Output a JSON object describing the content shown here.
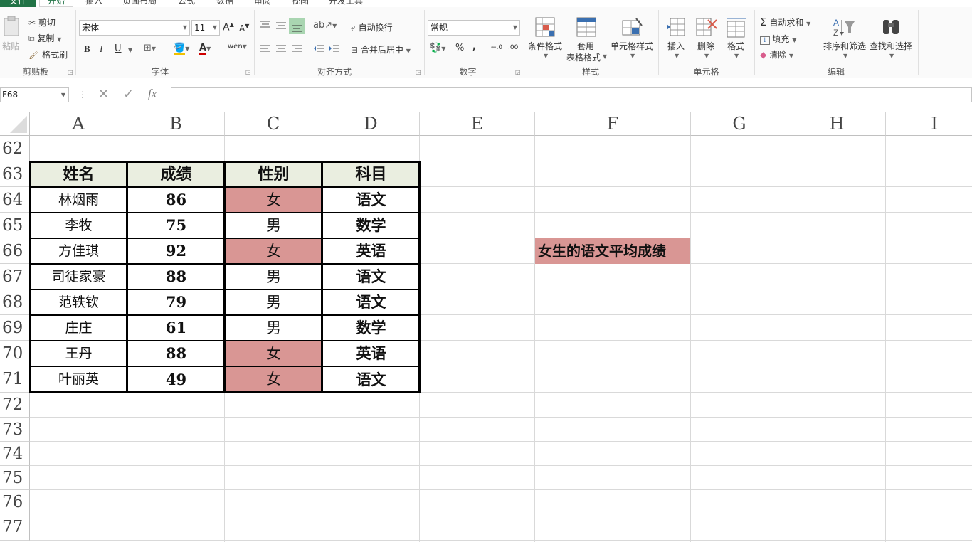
{
  "tabs": [
    "文件",
    "开始",
    "插入",
    "页面布局",
    "公式",
    "数据",
    "审阅",
    "视图",
    "开发工具"
  ],
  "clipboard": {
    "paste": "粘贴",
    "paste_sub": "粘贴",
    "cut": "剪切",
    "copy": "复制",
    "format_painter": "格式刷",
    "group": "剪贴板"
  },
  "font": {
    "name": "宋体",
    "size": "11",
    "bold": "B",
    "italic": "I",
    "underline": "U",
    "group": "字体",
    "grow": "A",
    "shrink": "A",
    "wen": "wén"
  },
  "alignment": {
    "wrap": "自动换行",
    "merge": "合并后居中",
    "group": "对齐方式"
  },
  "number": {
    "format": "常规",
    "percent": "%",
    "comma": ",",
    "inc": "←.0",
    "dec": ".00",
    "group": "数字"
  },
  "styles": {
    "conditional": "条件格式",
    "table_line1": "套用",
    "table_line2": "表格格式",
    "cell_styles": "单元格样式",
    "group": "样式"
  },
  "cells": {
    "insert": "插入",
    "delete": "删除",
    "format": "格式",
    "group": "单元格"
  },
  "editing": {
    "autosum": "自动求和",
    "fill": "填充",
    "clear": "清除",
    "sort": "排序和筛选",
    "find": "查找和选择",
    "group": "编辑"
  },
  "formula_bar": {
    "name_box": "F68",
    "cancel": "✕",
    "enter": "✓",
    "fx": "fx",
    "value": ""
  },
  "columns": [
    "A",
    "B",
    "C",
    "D",
    "E",
    "F",
    "G",
    "H",
    "I"
  ],
  "rows": [
    "62",
    "63",
    "64",
    "65",
    "66",
    "67",
    "68",
    "69",
    "70",
    "71",
    "72",
    "73",
    "74",
    "75",
    "76",
    "77"
  ],
  "table": {
    "headers": [
      "姓名",
      "成绩",
      "性别",
      "科目"
    ],
    "records": [
      {
        "name": "林烟雨",
        "score": "86",
        "sex": "女",
        "subject": "语文"
      },
      {
        "name": "李牧",
        "score": "75",
        "sex": "男",
        "subject": "数学"
      },
      {
        "name": "方佳琪",
        "score": "92",
        "sex": "女",
        "subject": "英语"
      },
      {
        "name": "司徒家豪",
        "score": "88",
        "sex": "男",
        "subject": "语文"
      },
      {
        "name": "范轶钦",
        "score": "79",
        "sex": "男",
        "subject": "语文"
      },
      {
        "name": "庄庄",
        "score": "61",
        "sex": "男",
        "subject": "数学"
      },
      {
        "name": "王丹",
        "score": "88",
        "sex": "女",
        "subject": "英语"
      },
      {
        "name": "叶丽英",
        "score": "49",
        "sex": "女",
        "subject": "语文"
      }
    ]
  },
  "f66_text": "女生的语文平均成绩",
  "colors": {
    "excel_green": "#217346",
    "header_fill": "#eaeee0",
    "female_fill": "#d99694",
    "gridline": "#d9d9d9"
  }
}
